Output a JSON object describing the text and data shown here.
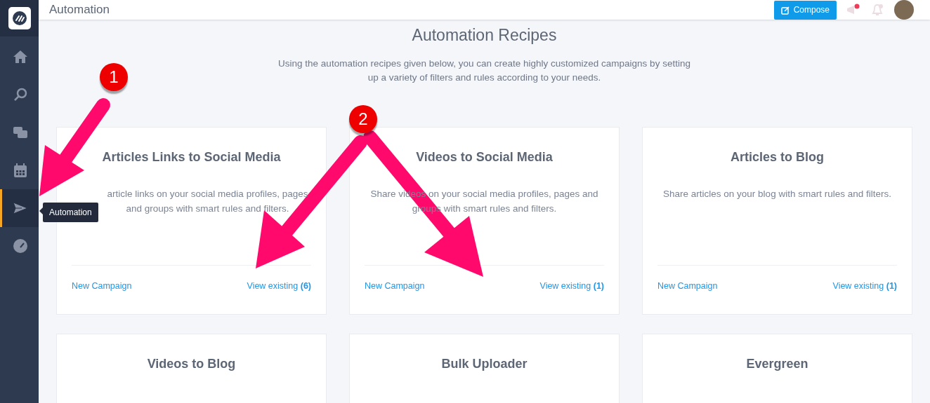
{
  "header": {
    "title": "Automation",
    "compose": "Compose"
  },
  "sidebar": {
    "items": [
      {
        "kind": "home",
        "selected": false
      },
      {
        "kind": "search",
        "selected": false
      },
      {
        "kind": "chat",
        "selected": false
      },
      {
        "kind": "calendar",
        "selected": false
      },
      {
        "kind": "send",
        "selected": true
      },
      {
        "kind": "gauge",
        "selected": false
      }
    ],
    "tooltip": "Automation"
  },
  "page": {
    "title": "Automation Recipes",
    "intro": "Using the automation recipes given below, you can create highly customized campaigns by setting up a variety of filters and rules according to your needs."
  },
  "recipes": [
    {
      "title": "Articles Links to Social Media",
      "description": "article links on your social media profiles, pages and groups with smart rules and filters.",
      "new_campaign": "New Campaign",
      "view_existing": "View existing **(6)**"
    },
    {
      "title": "Videos to Social Media",
      "description": "Share videos on your social media profiles, pages and groups with smart rules and filters.",
      "new_campaign": "New Campaign",
      "view_existing": "View existing **(1)**"
    },
    {
      "title": "Articles to Blog",
      "description": "Share articles on your blog with smart rules and filters.",
      "new_campaign": "New Campaign",
      "view_existing": "View existing **(1)**"
    },
    {
      "title": "Videos to Blog"
    },
    {
      "title": "Bulk Uploader"
    },
    {
      "title": "Evergreen"
    }
  ],
  "annotations": [
    "1",
    "2"
  ]
}
